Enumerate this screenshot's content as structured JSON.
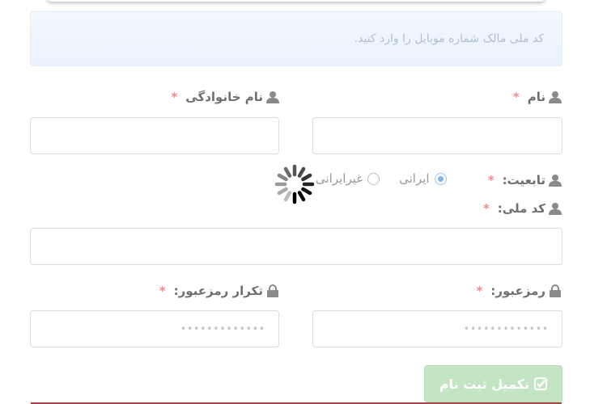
{
  "alert": {
    "text": "کد ملی مالک شماره موبایل را وارد کنید."
  },
  "form": {
    "first_name": {
      "label": "نام",
      "required_mark": "*",
      "icon": "user-icon",
      "value": ""
    },
    "last_name": {
      "label": "نام خانوادگی",
      "required_mark": "*",
      "icon": "user-icon",
      "value": ""
    },
    "nationality": {
      "label": "تابعیت:",
      "required_mark": "*",
      "icon": "user-icon",
      "options": [
        {
          "label": "ایرانی",
          "checked": true
        },
        {
          "label": "غیرایرانی",
          "checked": false
        }
      ]
    },
    "national_code": {
      "label": "کد ملی:",
      "required_mark": "*",
      "icon": "user-icon",
      "value": ""
    },
    "password": {
      "label": "رمزعبور:",
      "required_mark": "*",
      "icon": "lock-icon",
      "placeholder": "•••••••••••••"
    },
    "password_confirm": {
      "label": "تکرار رمزعبور:",
      "required_mark": "*",
      "icon": "lock-icon",
      "placeholder": "•••••••••••••"
    },
    "submit": {
      "label": "تکمیل ثبت نام",
      "icon": "check-square-icon"
    }
  },
  "loading": {
    "icon": "loading-spinner-icon"
  },
  "colors": {
    "required": "#f08a8a",
    "submit_bg": "#c3e5c3",
    "radio_checked": "#7fb4ef",
    "alert_bg": "#eef5fd",
    "bottom_line": "#a94442"
  }
}
